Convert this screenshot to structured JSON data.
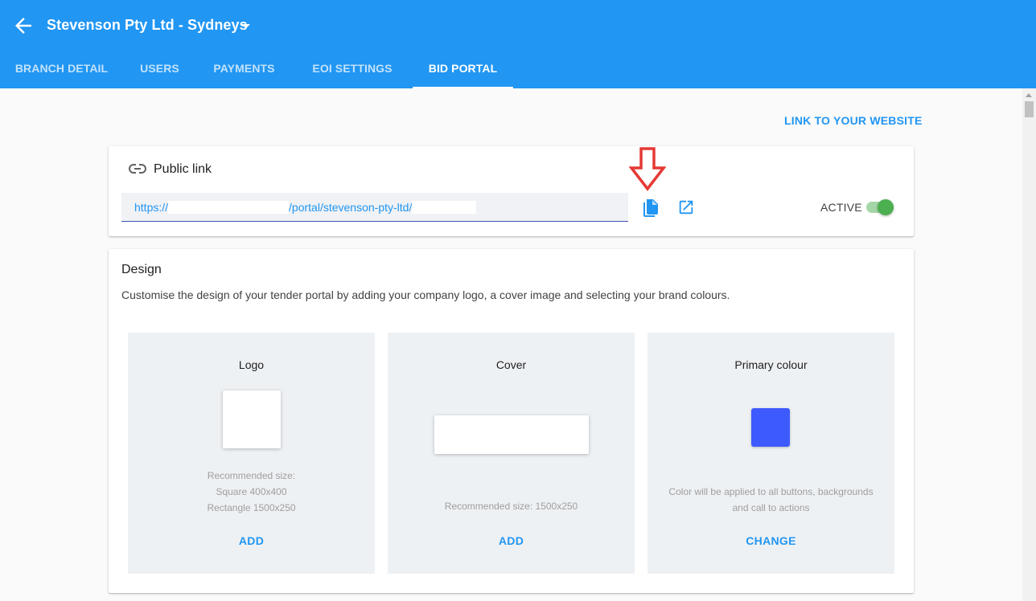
{
  "header": {
    "title": "Stevenson Pty Ltd - Sydneys",
    "back_icon": "arrow-left-icon",
    "dropdown_icon": "caret-down-icon",
    "background_color": "#2196f3"
  },
  "tabs": [
    {
      "label": "BRANCH DETAIL",
      "active": false
    },
    {
      "label": "USERS",
      "active": false
    },
    {
      "label": "PAYMENTS",
      "active": false
    },
    {
      "label": "EOI SETTINGS",
      "active": false
    },
    {
      "label": "BID PORTAL",
      "active": true
    }
  ],
  "link_to_website": "LINK TO YOUR WEBSITE",
  "public_link": {
    "title": "Public link",
    "url_prefix": "https://",
    "url_middle": "/portal/stevenson-pty-ltd/",
    "status_label": "ACTIVE",
    "active": true
  },
  "design": {
    "title": "Design",
    "description": "Customise the design of your tender portal by adding your company logo, a cover image and selecting your brand colours.",
    "panels": {
      "logo": {
        "title": "Logo",
        "notes": [
          "Recommended size:",
          "Square 400x400",
          "Rectangle 1500x250"
        ],
        "action": "ADD"
      },
      "cover": {
        "title": "Cover",
        "notes": [
          "Recommended size: 1500x250"
        ],
        "action": "ADD"
      },
      "colour": {
        "title": "Primary colour",
        "notes": [
          "Color will be applied to all buttons, backgrounds",
          "and call to actions"
        ],
        "action": "CHANGE",
        "value": "#3d5afe"
      }
    }
  },
  "colors": {
    "accent": "#2196f3",
    "toggle_on": "#4caf50",
    "annotation_arrow": "#e53935"
  }
}
